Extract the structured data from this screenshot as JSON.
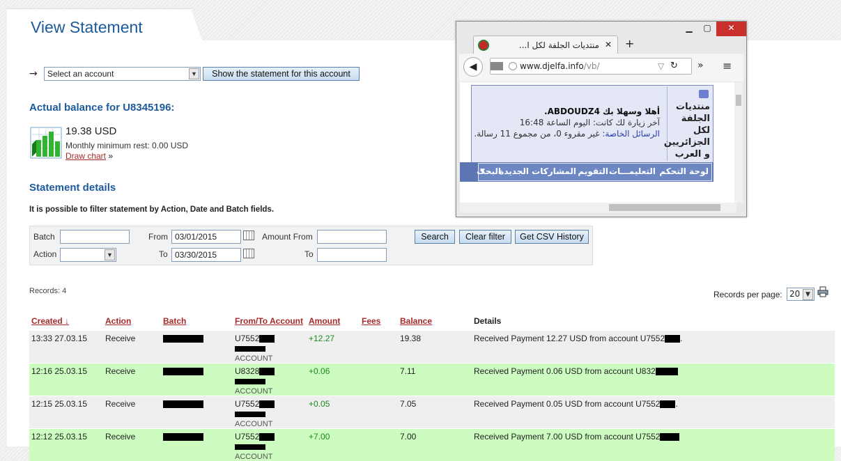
{
  "page": {
    "title": "View Statement",
    "arrow": "→",
    "account_select": "Select an account",
    "show_button": "Show the statement for this account",
    "balance_heading": "Actual balance for U8345196:",
    "balance_value": "19.38 USD",
    "min_rest": "Monthly minimum rest: 0.00 USD",
    "draw_chart": "Draw chart",
    "draw_chart_suffix": "»",
    "details_heading": "Statement details",
    "filter_info": "It is possible to filter statement by Action, Date and Batch fields."
  },
  "filter": {
    "batch_label": "Batch",
    "action_label": "Action",
    "from_label": "From",
    "to_label": "To",
    "from_value": "03/01/2015",
    "to_value": "03/30/2015",
    "amount_from_label": "Amount From",
    "amount_to_label": "To",
    "search": "Search",
    "clear": "Clear filter",
    "csv": "Get CSV History"
  },
  "records": {
    "count": "Records: 4",
    "per_page_label": "Records per page:",
    "per_page": "20"
  },
  "table": {
    "headers": {
      "created": "Created ↓",
      "action": "Action",
      "batch": "Batch",
      "account": "From/To Account",
      "amount": "Amount",
      "fees": "Fees",
      "balance": "Balance",
      "details": "Details"
    },
    "rows": [
      {
        "created": "13:33 27.03.15",
        "action": "Receive",
        "acct": "U7552",
        "acct_sub": "ACCOUNT",
        "amount": "+12.27",
        "balance": "19.38",
        "details": "Received Payment 12.27 USD from account U7552",
        "details_end": "."
      },
      {
        "created": "12:16 25.03.15",
        "action": "Receive",
        "acct": "U8328",
        "acct_sub": "ACCOUNT",
        "amount": "+0.06",
        "balance": "7.11",
        "details": "Received Payment 0.06 USD from account U832",
        "details_end": ""
      },
      {
        "created": "12:15 25.03.15",
        "action": "Receive",
        "acct": "U7552",
        "acct_sub": "ACCOUNT",
        "amount": "+0.05",
        "balance": "7.05",
        "details": "Received Payment 0.05 USD from account U7552",
        "details_end": "."
      },
      {
        "created": "12:12 25.03.15",
        "action": "Receive",
        "acct": "U7552",
        "acct_sub": "ACCOUNT",
        "amount": "+7.00",
        "balance": "7.00",
        "details": "Received Payment 7.00 USD from account U7552",
        "details_end": ""
      }
    ]
  },
  "browser": {
    "tab_title": "منتديات الجلفة لكل ا...",
    "url_host": "www.djelfa.info",
    "url_path": "/vb/",
    "forum_name": "منتديات الجلفة لكل الجزائريين و العرب",
    "welcome": "أهلا وسهلا بك ABDOUDZ4.",
    "last_visit": "آخر زيارة لك كانت: اليوم الساعة 16:48",
    "pm_link": "الرسائل الخاصة:",
    "pm_text": "غير مقروء 0، من مجموع 11 رسالة.",
    "nav": [
      "لوحة التحكم",
      "التعليمـــات",
      "التقويم",
      "المشاركات الجديدة",
      "البحث"
    ]
  },
  "colors": {
    "title_blue": "#1c5a9b",
    "sort_link": "#a52a2a",
    "row_green": "#ccfcc0",
    "row_grey": "#efefef",
    "amount_green": "#1a8a1a",
    "close_red": "#c9302c"
  }
}
